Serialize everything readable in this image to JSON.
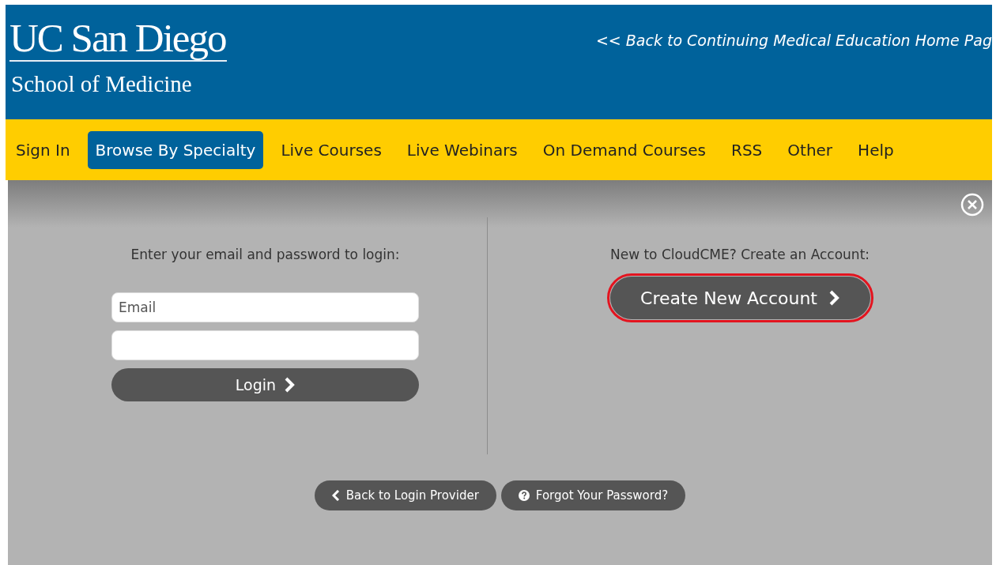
{
  "header": {
    "logo_title": "UC San Diego",
    "logo_subtitle": "School of Medicine",
    "back_link": "<< Back to Continuing Medical Education Home Pag"
  },
  "nav": [
    {
      "label": "Sign In",
      "selected": false
    },
    {
      "label": "Browse By Specialty",
      "selected": true
    },
    {
      "label": "Live Courses",
      "selected": false
    },
    {
      "label": "Live Webinars",
      "selected": false
    },
    {
      "label": "On Demand Courses",
      "selected": false
    },
    {
      "label": "RSS",
      "selected": false
    },
    {
      "label": "Other",
      "selected": false
    },
    {
      "label": "Help",
      "selected": false
    }
  ],
  "login": {
    "prompt": "Enter your email and password to login:",
    "email": {
      "placeholder": "Email"
    },
    "button": "Login"
  },
  "signup": {
    "prompt": "New to CloudCME? Create an Account:",
    "button": "Create New Account",
    "highlighted": true
  },
  "footer_buttons": [
    {
      "label": "Back to Login Provider",
      "kind": "back"
    },
    {
      "label": "Forgot Your Password?",
      "kind": "help"
    }
  ]
}
